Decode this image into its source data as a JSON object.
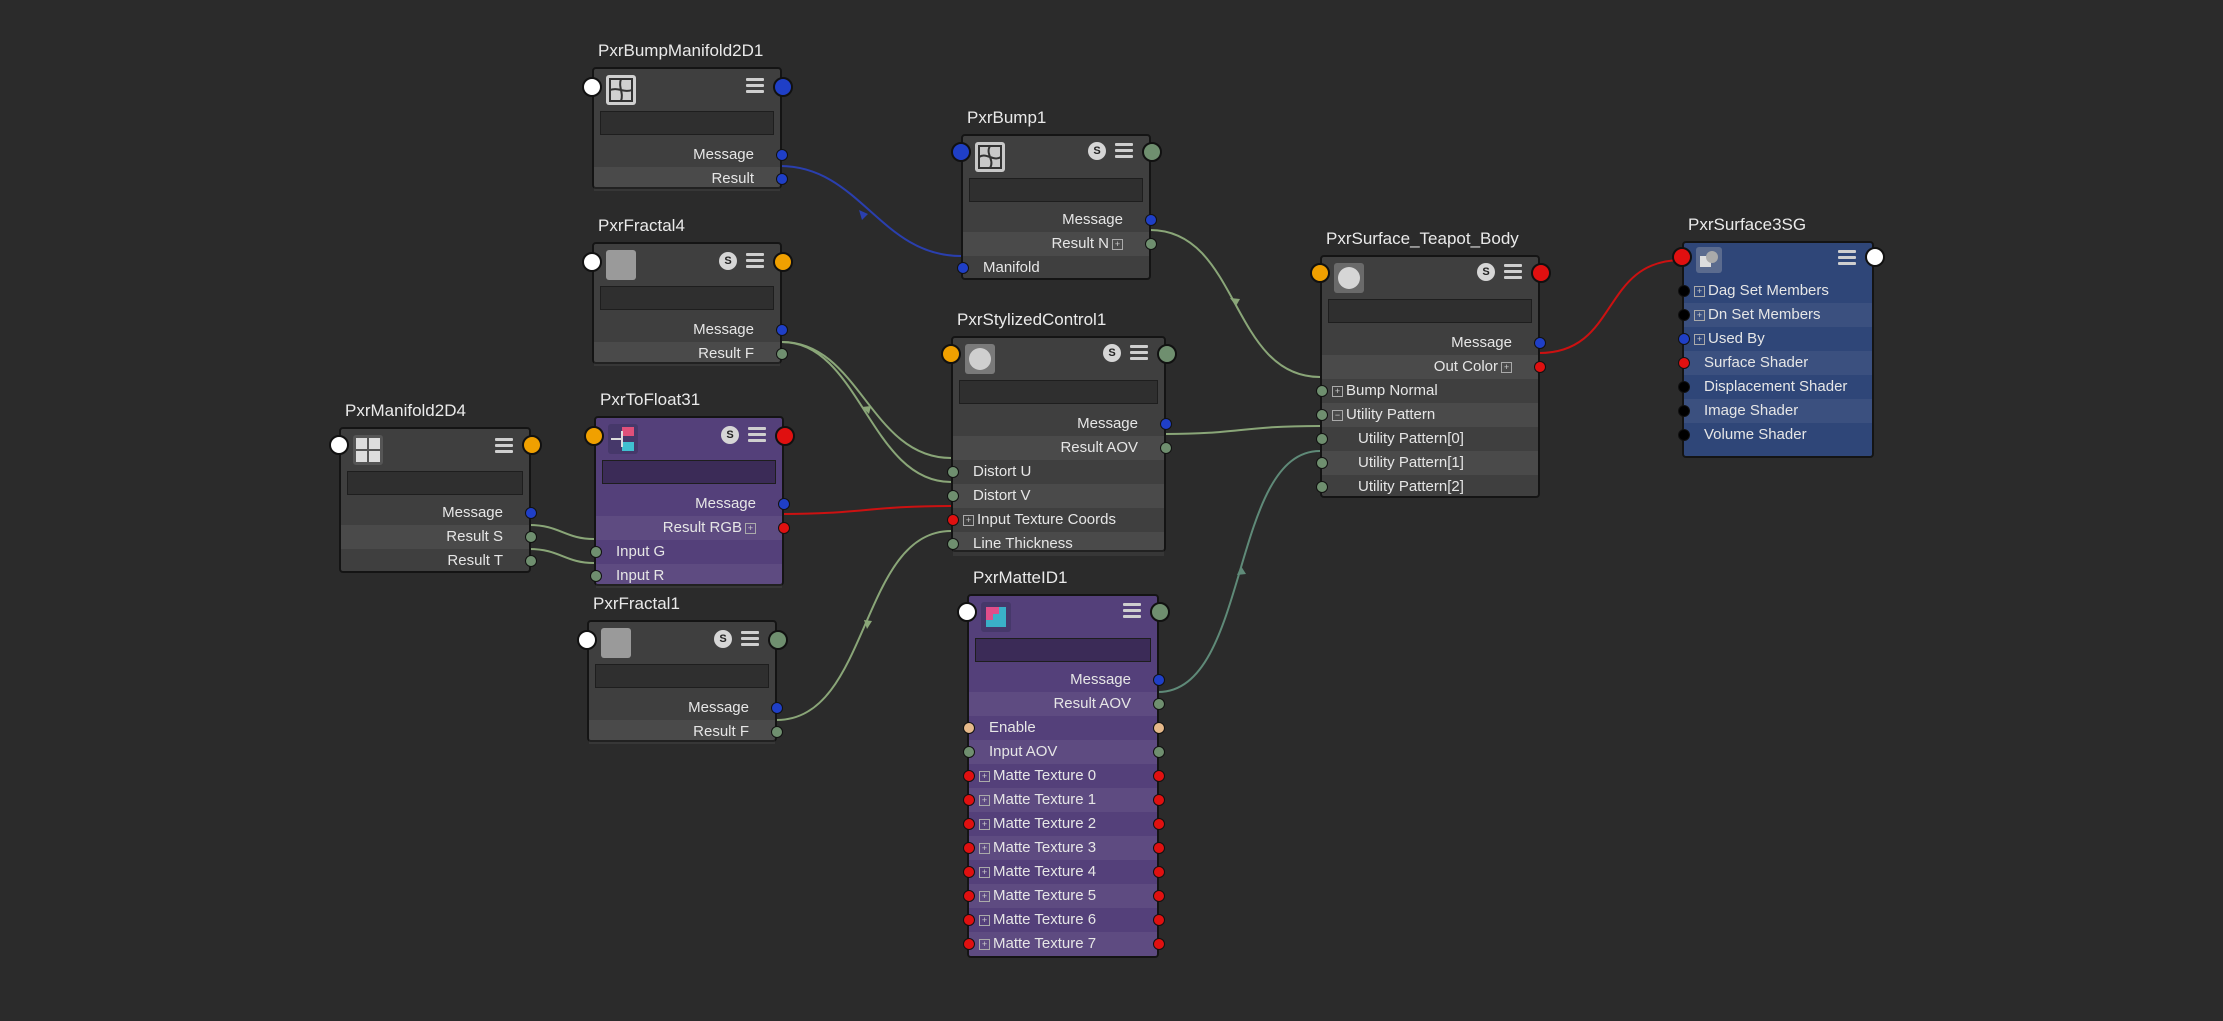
{
  "colors": {
    "background": "#2b2b2b",
    "node_gray": "#3f3f3f",
    "node_purple": "#54407a",
    "node_blue": "#2f4678",
    "port_blue": "#1f3fc7",
    "port_green": "#6f8f6f",
    "port_red": "#e01010",
    "port_orange": "#f0a000",
    "port_white": "#ffffff",
    "port_black": "#000000",
    "port_peach": "#e6b98a",
    "wire_green": "#8aa678",
    "wire_blue": "#2a3fae",
    "wire_red": "#cc1111"
  },
  "nodes": {
    "bump_manifold": {
      "title": "PxrBumpManifold2D1",
      "icon": "manifold-icon",
      "outputs": [
        "Message",
        "Result"
      ]
    },
    "fractal4": {
      "title": "PxrFractal4",
      "icon": "fractal-icon",
      "outputs": [
        "Message",
        "Result F"
      ]
    },
    "manifold2d4": {
      "title": "PxrManifold2D4",
      "icon": "grid-icon",
      "outputs": [
        "Message",
        "Result S",
        "Result T"
      ]
    },
    "tofloat31": {
      "title": "PxrToFloat31",
      "icon": "tofloat-icon",
      "outputs": [
        "Message",
        "Result RGB"
      ],
      "inputs": [
        "Input G",
        "Input R"
      ]
    },
    "fractal1": {
      "title": "PxrFractal1",
      "icon": "fractal-icon",
      "outputs": [
        "Message",
        "Result F"
      ]
    },
    "bump1": {
      "title": "PxrBump1",
      "icon": "bump-icon",
      "outputs": [
        "Message",
        "Result N"
      ],
      "inputs": [
        "Manifold"
      ]
    },
    "stylized": {
      "title": "PxrStylizedControl1",
      "icon": "sphere-icon",
      "outputs": [
        "Message",
        "Result AOV"
      ],
      "inputs": [
        "Distort U",
        "Distort V",
        "Input Texture Coords",
        "Line Thickness"
      ]
    },
    "matteid": {
      "title": "PxrMatteID1",
      "icon": "matte-icon",
      "outputs": [
        "Message",
        "Result AOV"
      ],
      "inputs": [
        "Enable",
        "Input AOV",
        "Matte Texture 0",
        "Matte Texture 1",
        "Matte Texture 2",
        "Matte Texture 3",
        "Matte Texture 4",
        "Matte Texture 5",
        "Matte Texture 6",
        "Matte Texture 7"
      ]
    },
    "surface": {
      "title": "PxrSurface_Teapot_Body",
      "icon": "sphere-icon",
      "outputs": [
        "Message",
        "Out Color"
      ],
      "inputs": [
        "Bump Normal",
        "Utility Pattern",
        "Utility Pattern[0]",
        "Utility Pattern[1]",
        "Utility Pattern[2]"
      ]
    },
    "sg": {
      "title": "PxrSurface3SG",
      "icon": "shading-group-icon",
      "inputs": [
        "Dag Set Members",
        "Dn Set Members",
        "Used By",
        "Surface Shader",
        "Displacement Shader",
        "Image Shader",
        "Volume Shader"
      ]
    }
  },
  "badges": {
    "swatch": "S"
  }
}
